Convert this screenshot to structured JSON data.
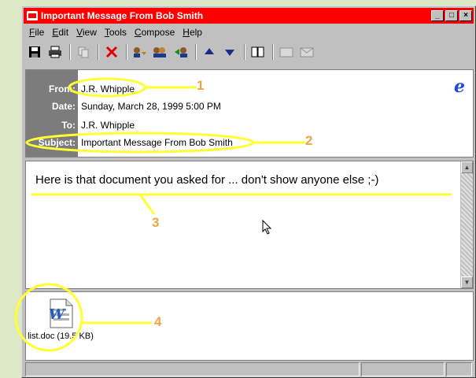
{
  "window": {
    "title": "Important Message From Bob Smith"
  },
  "menu": [
    {
      "label": "File",
      "ul": "F",
      "rest": "ile"
    },
    {
      "label": "Edit",
      "ul": "E",
      "rest": "dit"
    },
    {
      "label": "View",
      "ul": "V",
      "rest": "iew"
    },
    {
      "label": "Tools",
      "ul": "T",
      "rest": "ools"
    },
    {
      "label": "Compose",
      "ul": "C",
      "rest": "ompose"
    },
    {
      "label": "Help",
      "ul": "H",
      "rest": "elp"
    }
  ],
  "header": {
    "from_label": "From:",
    "from": "J.R. Whipple",
    "date_label": "Date:",
    "date": "Sunday, March 28, 1999 5:00 PM",
    "to_label": "To:",
    "to": "J.R. Whipple",
    "subject_label": "Subject:",
    "subject": "Important Message From Bob Smith"
  },
  "body": {
    "text": "Here is that document you asked for ... don't show anyone else ;-)"
  },
  "attachment": {
    "name": "list.doc (19.5 KB)"
  },
  "annotations": [
    "1",
    "2",
    "3",
    "4"
  ],
  "colors": {
    "title_bar": "#ff0000",
    "annotation": "#ffff33",
    "number": "#f0a340",
    "background": "#dde9c6"
  }
}
